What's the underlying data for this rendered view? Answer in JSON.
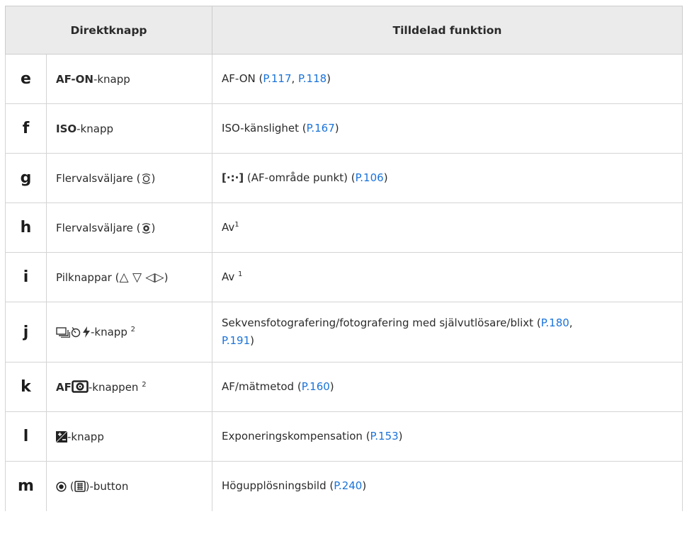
{
  "header": {
    "col_button": "Direktknapp",
    "col_function": "Tilldelad funktion"
  },
  "rows": [
    {
      "letter": "e",
      "button_bold": "AF-ON",
      "button_rest": "-knapp",
      "func_prefix": "AF-ON (",
      "ref1": "P.117",
      "sep": ", ",
      "ref2": "P.118",
      "func_suffix": ")"
    },
    {
      "letter": "f",
      "button_bold": "ISO",
      "button_rest": "-knapp",
      "func_prefix": "ISO-känslighet (",
      "ref1": "P.167",
      "func_suffix": ")"
    },
    {
      "letter": "g",
      "button_pre": "Flervalsväljare (",
      "button_post": ")",
      "func_symbol": "[·:·]",
      "func_prefix": " (AF-område punkt) (",
      "ref1": "P.106",
      "func_suffix": ")"
    },
    {
      "letter": "h",
      "button_pre": "Flervalsväljare (",
      "button_post": ")",
      "func_text": "Av",
      "func_sup": "1"
    },
    {
      "letter": "i",
      "button_pre": "Pilknappar (",
      "arrows": "△ ▽ ◁▷",
      "button_post": ")",
      "func_text": "Av ",
      "func_sup": "1"
    },
    {
      "letter": "j",
      "button_rest": "-knapp ",
      "button_sup": "2",
      "func_prefix": "Sekvensfotografering/fotografering med självutlösare/blixt (",
      "ref1": "P.180",
      "sep": ", ",
      "ref2": "P.191",
      "func_suffix": ")"
    },
    {
      "letter": "k",
      "button_bold": "AF",
      "button_rest": "-knappen ",
      "button_sup": "2",
      "func_prefix": "AF/mätmetod (",
      "ref1": "P.160",
      "func_suffix": ")"
    },
    {
      "letter": "l",
      "button_rest": "-knapp",
      "func_prefix": "Exponeringskompensation (",
      "ref1": "P.153",
      "func_suffix": ")"
    },
    {
      "letter": "m",
      "button_pre": " (",
      "button_post": ")-button",
      "func_prefix": "Högupplösningsbild (",
      "ref1": "P.240",
      "func_suffix": ")"
    }
  ]
}
